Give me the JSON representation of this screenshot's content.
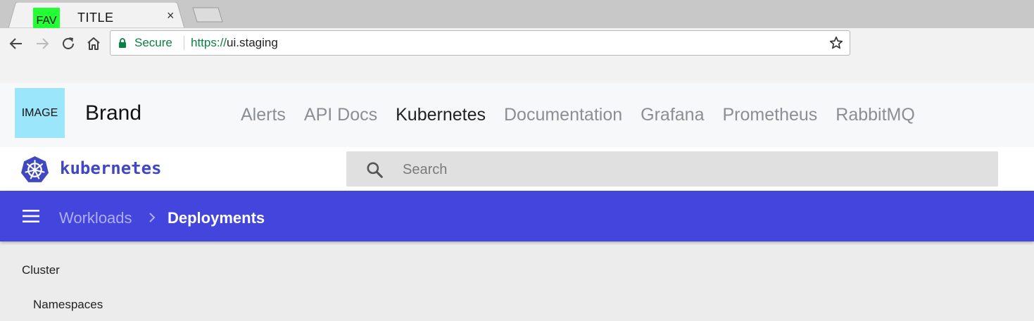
{
  "browser": {
    "tab": {
      "favicon_label": "FAV",
      "title": "TITLE",
      "close_glyph": "×"
    },
    "omnibox": {
      "secure_label": "Secure",
      "url_scheme": "https://",
      "url_host": "ui.staging"
    },
    "icons": [
      "back-icon",
      "forward-icon",
      "reload-icon",
      "home-icon",
      "lock-icon",
      "star-icon"
    ]
  },
  "site_header": {
    "logo_label": "IMAGE",
    "brand": "Brand",
    "nav": [
      {
        "label": "Alerts"
      },
      {
        "label": "API Docs"
      },
      {
        "label": "Kubernetes",
        "active": true
      },
      {
        "label": "Documentation"
      },
      {
        "label": "Grafana"
      },
      {
        "label": "Prometheus"
      },
      {
        "label": "RabbitMQ"
      }
    ]
  },
  "k8s": {
    "wordmark": "kubernetes",
    "search": {
      "placeholder": "Search",
      "value": ""
    }
  },
  "breadcrumb": {
    "parent": "Workloads",
    "current": "Deployments"
  },
  "sidebar": {
    "heading": "Cluster",
    "items": [
      {
        "label": "Namespaces"
      }
    ]
  },
  "colors": {
    "accent": "#4345dc",
    "k8s_blue": "#3f48c0",
    "secure_green": "#0b8043",
    "favicon": "#22ff33",
    "logo_bg": "#9be6fb"
  }
}
